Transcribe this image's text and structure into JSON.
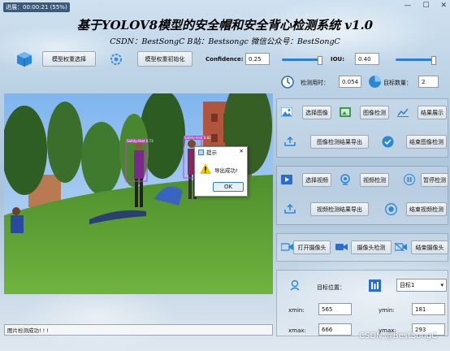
{
  "window": {
    "title": "进展：00:00:21 (55%)",
    "min": "—",
    "max": "☐",
    "close": "✕"
  },
  "header": {
    "title": "基于YOLOV8模型的安全帽和安全背心检测系统 v1.0",
    "subtitle": "CSDN：BestSongC   B站：Bestsongc   微信公众号：BestSongC"
  },
  "model": {
    "select_weights": "模型权重选择",
    "init_weights": "模型权重初始化",
    "confidence_label": "Confidence:",
    "confidence_value": "0.25",
    "iou_label": "IOU:",
    "iou_value": "0.40",
    "confidence_level": 0.25,
    "iou_level": 0.4
  },
  "stats": {
    "time_label": "检测用时：",
    "time_value": "0.054",
    "count_label": "目标数量：",
    "count_value": "2"
  },
  "image_section": {
    "select": "选择图像",
    "detect": "图像检测",
    "show": "结果展示",
    "export": "图像检测结果导出",
    "end": "结束图像检测"
  },
  "video_section": {
    "select": "选择视频",
    "detect": "视频检测",
    "pause": "暂停检测",
    "export": "视频检测结果导出",
    "end": "结束视频检测"
  },
  "camera_section": {
    "open": "打开摄像头",
    "detect": "摄像头检测",
    "end": "结束摄像头"
  },
  "target": {
    "position_label": "目标位置：",
    "select_value": "目标1",
    "xmin_label": "xmin:",
    "xmin_value": "565",
    "ymin_label": "ymin:",
    "ymin_value": "181",
    "xmax_label": "xmax:",
    "xmax_value": "666",
    "ymax_label": "ymax:",
    "ymax_value": "293"
  },
  "detections": [
    {
      "label": "Safety-Vest 0.73"
    },
    {
      "label": "Safety-Vest 0.82"
    }
  ],
  "dialog": {
    "title": "提示",
    "message": "导出成功!",
    "ok": "OK",
    "close": "✕"
  },
  "status": {
    "text": "图片检测成功! ! !"
  },
  "watermark": "CSDN @BestSongC",
  "colors": {
    "accent": "#2f7fd0",
    "box": "#c040d0"
  }
}
